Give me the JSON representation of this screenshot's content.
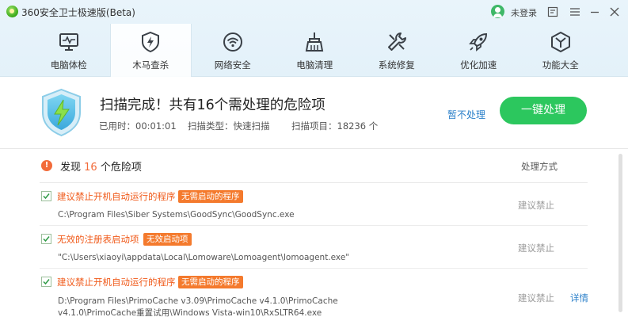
{
  "window": {
    "title": "360安全卫士极速版(Beta)",
    "login_label": "未登录"
  },
  "nav": {
    "items": [
      {
        "label": "电脑体检",
        "icon": "monitor-pulse-icon"
      },
      {
        "label": "木马查杀",
        "icon": "shield-bolt-icon"
      },
      {
        "label": "网络安全",
        "icon": "wifi-icon"
      },
      {
        "label": "电脑清理",
        "icon": "broom-icon"
      },
      {
        "label": "系统修复",
        "icon": "wrench-icon"
      },
      {
        "label": "优化加速",
        "icon": "rocket-icon"
      },
      {
        "label": "功能大全",
        "icon": "cube-icon"
      }
    ],
    "active_index": 1
  },
  "summary": {
    "title": "扫描完成！共有16个需处理的危险项",
    "time_label": "已用时：",
    "time_value": "00:01:01",
    "type_label": "扫描类型：",
    "type_value": "快速扫描",
    "items_label": "扫描项目：",
    "items_value": "18236 个",
    "ignore_label": "暂不处理",
    "fix_label": "一键处理"
  },
  "list": {
    "head_prefix": "发现",
    "head_count": "16",
    "head_suffix": "个危险项",
    "action_header": "处理方式",
    "items": [
      {
        "title": "建议禁止开机自动运行的程序",
        "tag": "无需启动的程序",
        "path_line1": "C:\\Program Files\\Siber Systems\\GoodSync\\GoodSync.exe",
        "path_line2": "",
        "action": "建议禁止",
        "detail": ""
      },
      {
        "title": "无效的注册表启动项",
        "tag": "无效启动项",
        "path_line1": "\"C:\\Users\\xiaoyi\\appdata\\Local\\Lomoware\\Lomoagent\\lomoagent.exe\"",
        "path_line2": "",
        "action": "建议禁止",
        "detail": ""
      },
      {
        "title": "建议禁止开机自动运行的程序",
        "tag": "无需启动的程序",
        "path_line1": "D:\\Program Files\\PrimoCache v3.09\\PrimoCache v4.1.0\\PrimoCache",
        "path_line2": "v4.1.0\\PrimoCache重置试用\\Windows Vista-win10\\RxSLTR64.exe",
        "action": "建议禁止",
        "detail": "详情"
      }
    ]
  },
  "colors": {
    "accent_green": "#2cc75e",
    "danger_orange": "#f26b3a",
    "link_blue": "#2a7fc9"
  }
}
